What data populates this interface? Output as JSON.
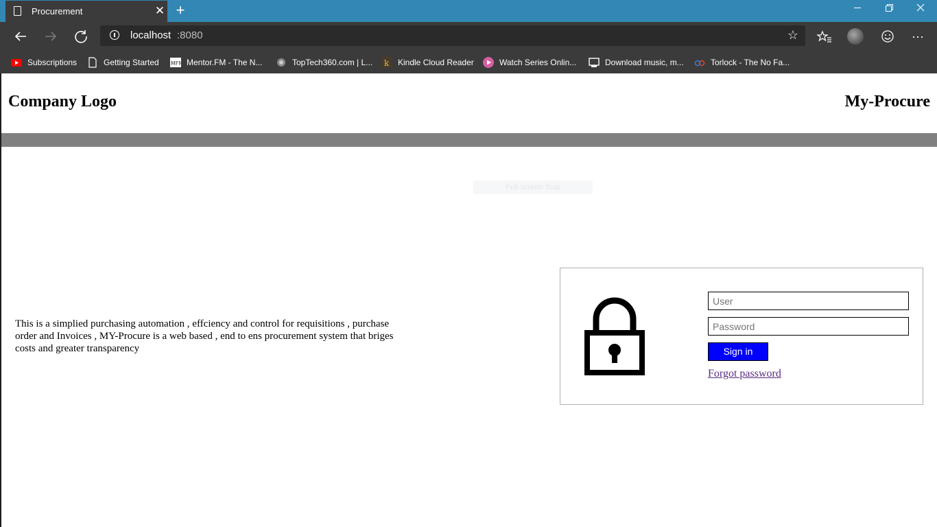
{
  "browser": {
    "tab_title": "Procurement",
    "url_host": "localhost",
    "url_port": ":8080",
    "bookmarks": [
      {
        "label": "Subscriptions",
        "icon": "youtube-icon"
      },
      {
        "label": "Getting Started",
        "icon": "document-icon"
      },
      {
        "label": "Mentor.FM - The N...",
        "icon": "mentorfm-icon"
      },
      {
        "label": "TopTech360.com | L...",
        "icon": "toptech-icon"
      },
      {
        "label": "Kindle Cloud Reader",
        "icon": "kindle-icon"
      },
      {
        "label": "Watch Series Onlin...",
        "icon": "play-icon"
      },
      {
        "label": "Download music, m...",
        "icon": "download-icon"
      },
      {
        "label": "Torlock - The No Fa...",
        "icon": "torlock-icon"
      }
    ]
  },
  "header": {
    "logo": "Company Logo",
    "app_name": "My-Procure"
  },
  "ghost_overlay": "Full-screen Snip",
  "description": "This is a simplied purchasing automation , effciency and control for requisitions , purchase order and Invoices , MY-Procure is a web based , end to ens procurement system that briges costs and greater transparency",
  "login": {
    "user_placeholder": "User",
    "password_placeholder": "Password",
    "signin_label": "Sign in",
    "forgot_label": "Forgot password"
  },
  "colors": {
    "titlebar": "#3287b5",
    "chrome": "#3b3b3b",
    "grey_bar": "#808080",
    "signin_bg": "#0000ff"
  }
}
